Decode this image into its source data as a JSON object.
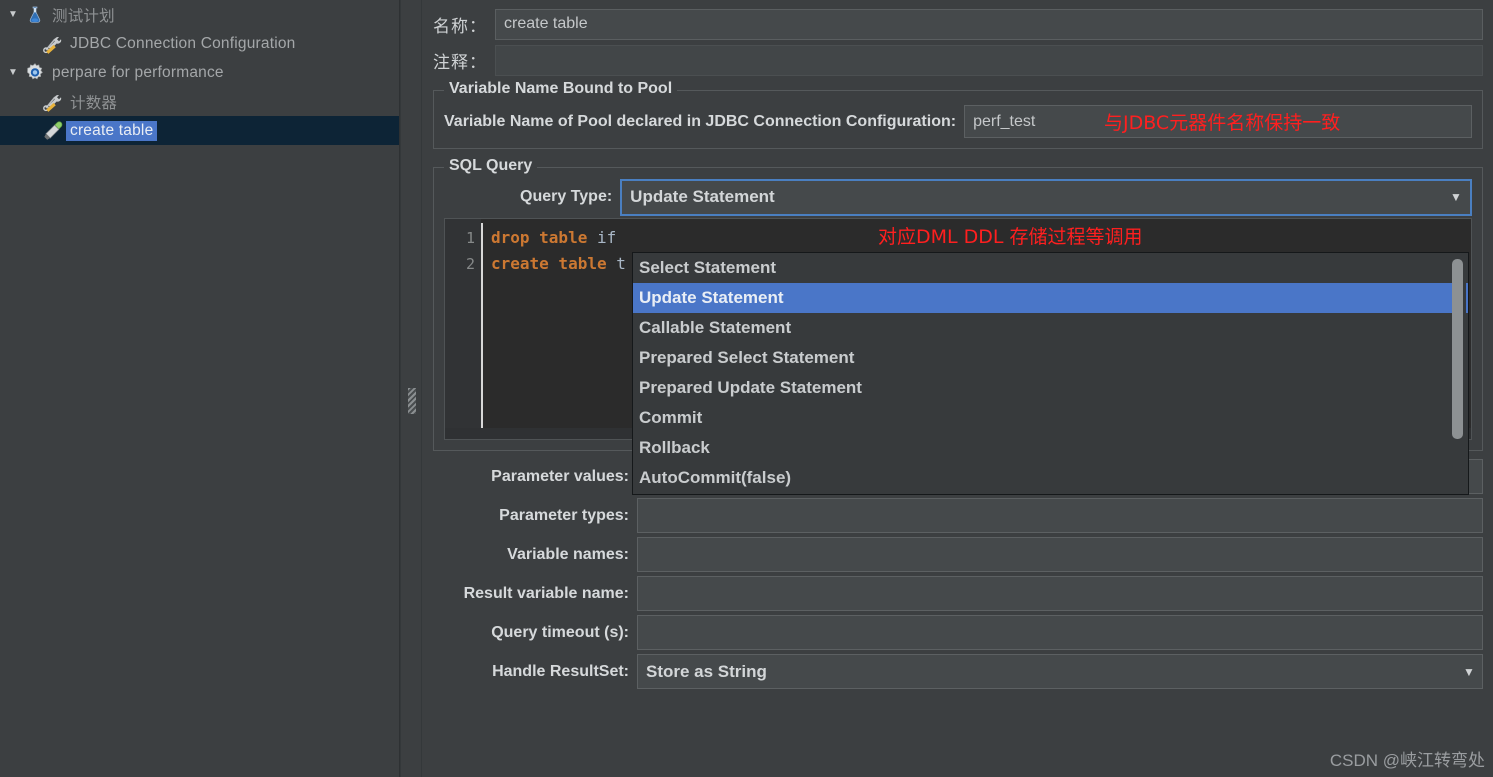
{
  "tree": {
    "items": [
      {
        "label": "测试计划",
        "icon": "flask-icon",
        "expanded": true,
        "depth": 0,
        "cjk": true,
        "selected": false
      },
      {
        "label": "JDBC Connection Configuration",
        "icon": "wrench-screwdriver-icon",
        "expanded": null,
        "depth": 1,
        "cjk": false,
        "selected": false
      },
      {
        "label": "perpare for performance",
        "icon": "gear-icon",
        "expanded": true,
        "depth": 1,
        "cjk": false,
        "selected": false
      },
      {
        "label": "计数器",
        "icon": "wrench-screwdriver-icon",
        "expanded": null,
        "depth": 2,
        "cjk": true,
        "selected": false
      },
      {
        "label": "create table",
        "icon": "pipette-icon",
        "expanded": null,
        "depth": 2,
        "cjk": false,
        "selected": true
      }
    ]
  },
  "header": {
    "name_label": "名称：",
    "name_value": "create table",
    "comment_label": "注释：",
    "comment_value": ""
  },
  "pool_group": {
    "title": "Variable Name Bound to Pool",
    "field_label": "Variable Name of Pool declared in JDBC Connection Configuration:",
    "field_value": "perf_test"
  },
  "sql_group": {
    "title": "SQL Query",
    "query_type_label": "Query Type:",
    "query_type_value": "Update Statement",
    "dropdown_options": [
      "Select Statement",
      "Update Statement",
      "Callable Statement",
      "Prepared Select Statement",
      "Prepared Update Statement",
      "Commit",
      "Rollback",
      "AutoCommit(false)"
    ],
    "dropdown_selected": "Update Statement",
    "editor": {
      "line_numbers": [
        "1",
        "2"
      ],
      "lines": [
        {
          "keyword": "drop table",
          "rest": " if"
        },
        {
          "keyword": "create table",
          "rest": " t"
        }
      ]
    }
  },
  "bottom_fields": [
    {
      "label": "Parameter values:",
      "value": "",
      "type": "text"
    },
    {
      "label": "Parameter types:",
      "value": "",
      "type": "text"
    },
    {
      "label": "Variable names:",
      "value": "",
      "type": "text"
    },
    {
      "label": "Result variable name:",
      "value": "",
      "type": "text"
    },
    {
      "label": "Query timeout (s):",
      "value": "",
      "type": "text"
    },
    {
      "label": "Handle ResultSet:",
      "value": "Store as String",
      "type": "combo"
    }
  ],
  "annotations": {
    "pool_note": "与JDBC元器件名称保持一致",
    "query_type_note": "对应DML DDL 存储过程等调用"
  },
  "watermark": "CSDN @峡江转弯处",
  "colors": {
    "background": "#3c3f41",
    "accent_blue": "#4a76c8",
    "focus_border": "#4a7fc1",
    "annotation_red": "#ff1f1f",
    "editor_bg": "#2b2b2b",
    "sql_keyword": "#cc7832",
    "selected_row": "#0d2436"
  },
  "icons": {
    "collapse_glyph": "▼",
    "combo_arrow_glyph": "▼"
  }
}
